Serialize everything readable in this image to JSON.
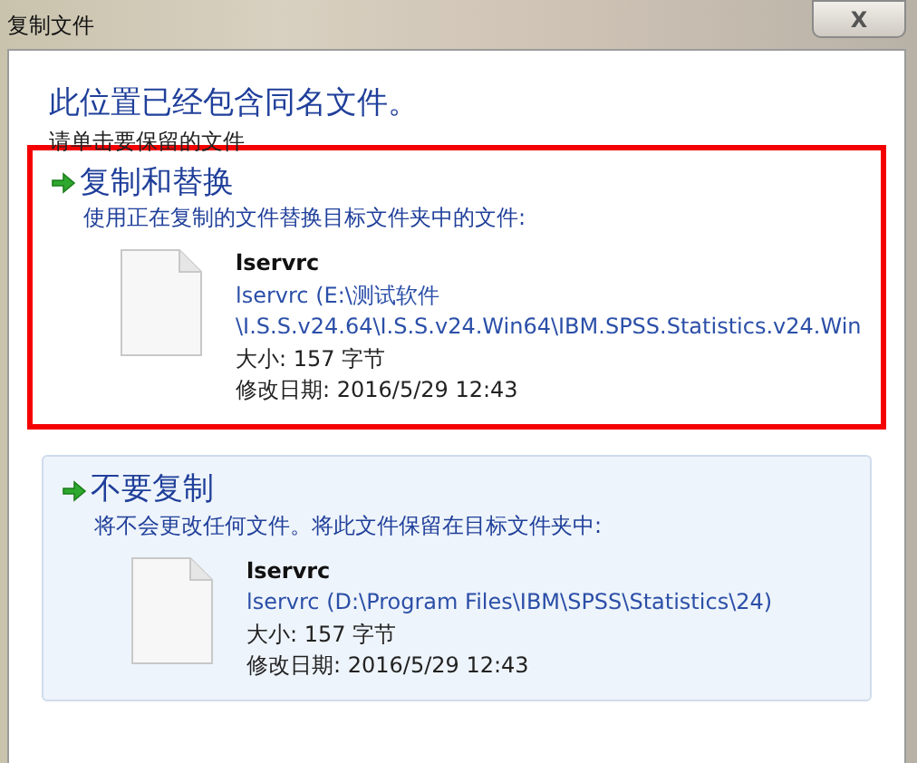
{
  "window": {
    "title": "复制文件",
    "close": "X"
  },
  "heading": "此位置已经包含同名文件。",
  "instruction": "请单击要保留的文件",
  "options": [
    {
      "title": "复制和替换",
      "description": "使用正在复制的文件替换目标文件夹中的文件:",
      "file_name": "lservrc",
      "path": "lservrc (E:\\测试软件\n\\I.S.S.v24.64\\I.S.S.v24.Win64\\IBM.SPSS.Statistics.v24.Win",
      "size": "大小: 157 字节",
      "modified": "修改日期: 2016/5/29 12:43",
      "highlighted": true,
      "hovered": false
    },
    {
      "title": "不要复制",
      "description": "将不会更改任何文件。将此文件保留在目标文件夹中:",
      "file_name": "lservrc",
      "path": "lservrc (D:\\Program Files\\IBM\\SPSS\\Statistics\\24)",
      "size": "大小: 157 字节",
      "modified": "修改日期: 2016/5/29 12:43",
      "highlighted": false,
      "hovered": true
    }
  ]
}
